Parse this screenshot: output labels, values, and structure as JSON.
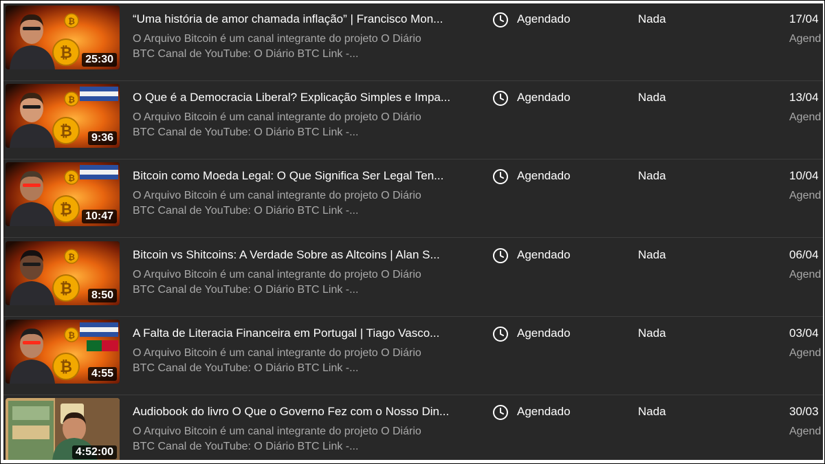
{
  "videos": [
    {
      "title": "“Uma história de amor chamada inflação” | Francisco Mon...",
      "description_line1": "O Arquivo Bitcoin é um canal integrante do projeto O Diário",
      "description_line2": "BTC Canal de YouTube: O Diário BTC Link -...",
      "duration": "25:30",
      "visibility_icon": "clock-icon",
      "visibility": "Agendado",
      "restrictions": "Nada",
      "date": "17/04",
      "date_status": "Agend"
    },
    {
      "title": "O Que é a Democracia Liberal? Explicação Simples e Impa...",
      "description_line1": "O Arquivo Bitcoin é um canal integrante do projeto O Diário",
      "description_line2": "BTC Canal de YouTube: O Diário BTC Link -...",
      "duration": "9:36",
      "visibility_icon": "clock-icon",
      "visibility": "Agendado",
      "restrictions": "Nada",
      "date": "13/04",
      "date_status": "Agend"
    },
    {
      "title": "Bitcoin como Moeda Legal: O Que Significa Ser Legal Ten...",
      "description_line1": "O Arquivo Bitcoin é um canal integrante do projeto O Diário",
      "description_line2": "BTC Canal de YouTube: O Diário BTC Link -...",
      "duration": "10:47",
      "visibility_icon": "clock-icon",
      "visibility": "Agendado",
      "restrictions": "Nada",
      "date": "10/04",
      "date_status": "Agend"
    },
    {
      "title": "Bitcoin vs Shitcoins: A Verdade Sobre as Altcoins | Alan S...",
      "description_line1": "O Arquivo Bitcoin é um canal integrante do projeto O Diário",
      "description_line2": "BTC Canal de YouTube: O Diário BTC Link -...",
      "duration": "8:50",
      "visibility_icon": "clock-icon",
      "visibility": "Agendado",
      "restrictions": "Nada",
      "date": "06/04",
      "date_status": "Agend"
    },
    {
      "title": "A Falta de Literacia Financeira em Portugal | Tiago Vasco...",
      "description_line1": "O Arquivo Bitcoin é um canal integrante do projeto O Diário",
      "description_line2": "BTC Canal de YouTube: O Diário BTC Link -...",
      "duration": "4:55",
      "visibility_icon": "clock-icon",
      "visibility": "Agendado",
      "restrictions": "Nada",
      "date": "03/04",
      "date_status": "Agend"
    },
    {
      "title": "Audiobook do livro O Que o Governo Fez com o Nosso Din...",
      "description_line1": "O Arquivo Bitcoin é um canal integrante do projeto O Diário",
      "description_line2": "BTC Canal de YouTube: O Diário BTC Link -...",
      "duration": "4:52:00",
      "visibility_icon": "clock-icon",
      "visibility": "Agendado",
      "restrictions": "Nada",
      "date": "30/03",
      "date_status": "Agend"
    }
  ],
  "colors": {
    "background": "#282828",
    "divider": "#3d3d3d",
    "primary_text": "#ffffff",
    "secondary_text": "#aaaaaa",
    "fire": "#e8650f",
    "bitcoin": "#f2a900"
  }
}
